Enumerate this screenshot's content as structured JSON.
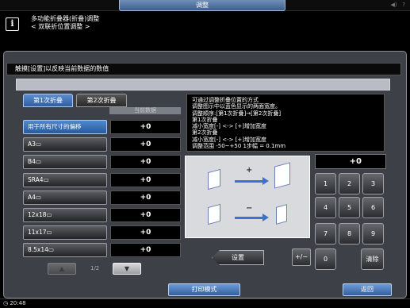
{
  "header": {
    "title": "调整",
    "icons": [
      "volume-icon",
      "help-icon"
    ]
  },
  "info": {
    "line1": "多功能折叠器(折叠)调整",
    "line2": "< 双联折位置调整 >"
  },
  "panel": {
    "title": "触摸[设置]以反映当前数据的数值"
  },
  "tabs": [
    {
      "label": "第1次折叠",
      "active": true
    },
    {
      "label": "第2次折叠",
      "active": false
    }
  ],
  "column_header": "当前数据",
  "rows": [
    {
      "label": "用于所有尺寸的偏移",
      "value": "+0",
      "selected": true
    },
    {
      "label": "A3▭",
      "value": "+0"
    },
    {
      "label": "B4▭",
      "value": "+0"
    },
    {
      "label": "SRA4▭",
      "value": "+0"
    },
    {
      "label": "A4▭",
      "value": "+0"
    },
    {
      "label": "12x18▭",
      "value": "+0"
    },
    {
      "label": "11x17▭",
      "value": "+0"
    },
    {
      "label": "8.5x14▭",
      "value": "+0"
    }
  ],
  "pager": {
    "text": "1/2",
    "up": "▲",
    "down": "▼"
  },
  "description": "可通过调整折叠位置的方式\n调整图示中以蓝色显示的两面宽度。\n调整顺序:[第1次折叠]→[第2次折叠]\n第1次折叠\n减小宽度[-] <-> [+]增加宽度\n第2次折叠\n减小宽度[-] <-> [+]增加宽度\n调整范围 -50~+50 1步幅 = 0.1mm",
  "diagram": {
    "plus": "+",
    "minus": "−"
  },
  "keypad": {
    "display": "+0",
    "keys": [
      "1",
      "2",
      "3",
      "4",
      "5",
      "6",
      "7",
      "8",
      "9",
      "0"
    ],
    "clear": "清除",
    "plusminus": "+/−"
  },
  "set_button": "设置",
  "bottom": {
    "print_mode": "打印模式",
    "back": "返回"
  },
  "status": {
    "time": "20:48"
  }
}
